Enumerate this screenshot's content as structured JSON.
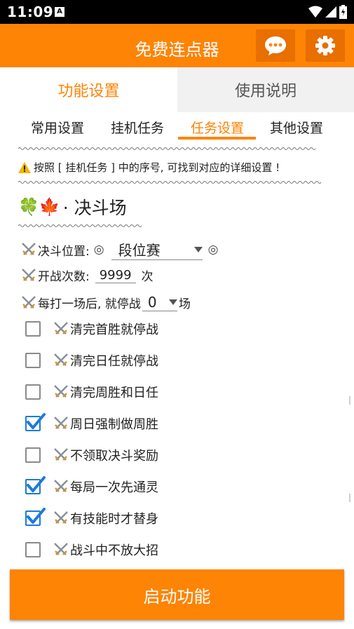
{
  "status": {
    "time": "11:09",
    "notif": "A"
  },
  "header": {
    "title": "免费连点器"
  },
  "main_tabs": [
    {
      "label": "功能设置",
      "active": true
    },
    {
      "label": "使用说明",
      "active": false
    }
  ],
  "sub_tabs": [
    {
      "label": "常用设置"
    },
    {
      "label": "挂机任务"
    },
    {
      "label": "任务设置",
      "active": true
    },
    {
      "label": "其他设置"
    }
  ],
  "notice": {
    "text": "按照 [ 挂机任务 ] 中的序号, 可找到对应的详细设置 !"
  },
  "section": {
    "emoji": "🍀🍁",
    "title": "· 决斗场"
  },
  "fields": {
    "position": {
      "label": "决斗位置:",
      "left_mark": "◎",
      "value": "段位赛",
      "right_mark": "◎"
    },
    "battles": {
      "label": "开战次数:",
      "value": "9999",
      "unit": "次"
    },
    "stop_after": {
      "label": "每打一场后, 就停战",
      "value": "0",
      "unit": "场"
    }
  },
  "options": [
    {
      "label": "清完首胜就停战",
      "checked": false
    },
    {
      "label": "清完日任就停战",
      "checked": false
    },
    {
      "label": "清完周胜和日任",
      "checked": false
    },
    {
      "label": "周日强制做周胜",
      "checked": true
    },
    {
      "label": "不领取决斗奖励",
      "checked": false
    },
    {
      "label": "每局一次先通灵",
      "checked": true
    },
    {
      "label": "有技能时才替身",
      "checked": true
    },
    {
      "label": "战斗中不放大招",
      "checked": false
    }
  ],
  "start_button": {
    "label": "启动功能"
  },
  "colors": {
    "accent": "#fd8405",
    "accent_dark": "#e86f00",
    "check": "#1d7bd8"
  }
}
